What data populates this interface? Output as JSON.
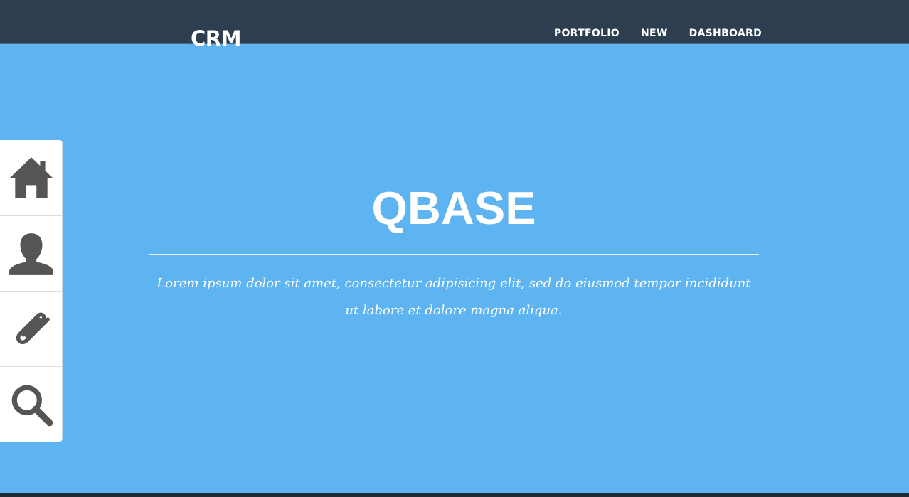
{
  "header": {
    "brand": "CRM",
    "nav": [
      {
        "label": "PORTFOLIO"
      },
      {
        "label": "NEW"
      },
      {
        "label": "DASHBOARD"
      }
    ]
  },
  "hero": {
    "title": "QBASE",
    "subtitle": "Lorem ipsum dolor sit amet, consectetur adipisicing elit, sed do eiusmod tempor incididunt ut labore et dolore magna aliqua."
  },
  "sidebar": {
    "items": [
      {
        "icon": "home-icon"
      },
      {
        "icon": "user-icon"
      },
      {
        "icon": "paperclip-icon"
      },
      {
        "icon": "search-icon"
      }
    ]
  },
  "colors": {
    "header_bg": "#2c3e50",
    "hero_bg": "#5db4f0",
    "icon": "#555555",
    "text": "#ffffff"
  }
}
